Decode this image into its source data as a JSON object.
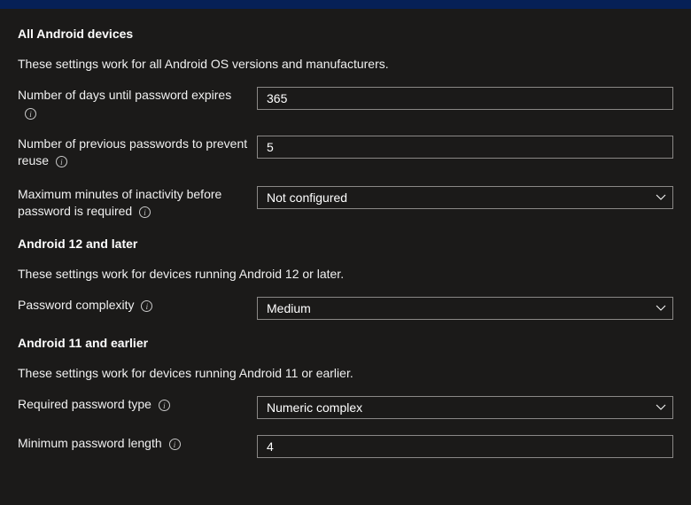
{
  "sections": {
    "allAndroid": {
      "heading": "All Android devices",
      "desc": "These settings work for all Android OS versions and manufacturers.",
      "fields": {
        "passwordExpiryDays": {
          "label": "Number of days until password expires",
          "value": "365"
        },
        "previousPasswords": {
          "label": "Number of previous passwords to prevent reuse",
          "value": "5"
        },
        "inactivityMinutes": {
          "label": "Maximum minutes of inactivity before password is required",
          "value": "Not configured"
        }
      }
    },
    "android12": {
      "heading": "Android 12 and later",
      "desc": "These settings work for devices running Android 12 or later.",
      "fields": {
        "passwordComplexity": {
          "label": "Password complexity",
          "value": "Medium"
        }
      }
    },
    "android11": {
      "heading": "Android 11 and earlier",
      "desc": "These settings work for devices running Android 11 or earlier.",
      "fields": {
        "requiredPasswordType": {
          "label": "Required password type",
          "value": "Numeric complex"
        },
        "minPasswordLength": {
          "label": "Minimum password length",
          "value": "4"
        }
      }
    }
  }
}
